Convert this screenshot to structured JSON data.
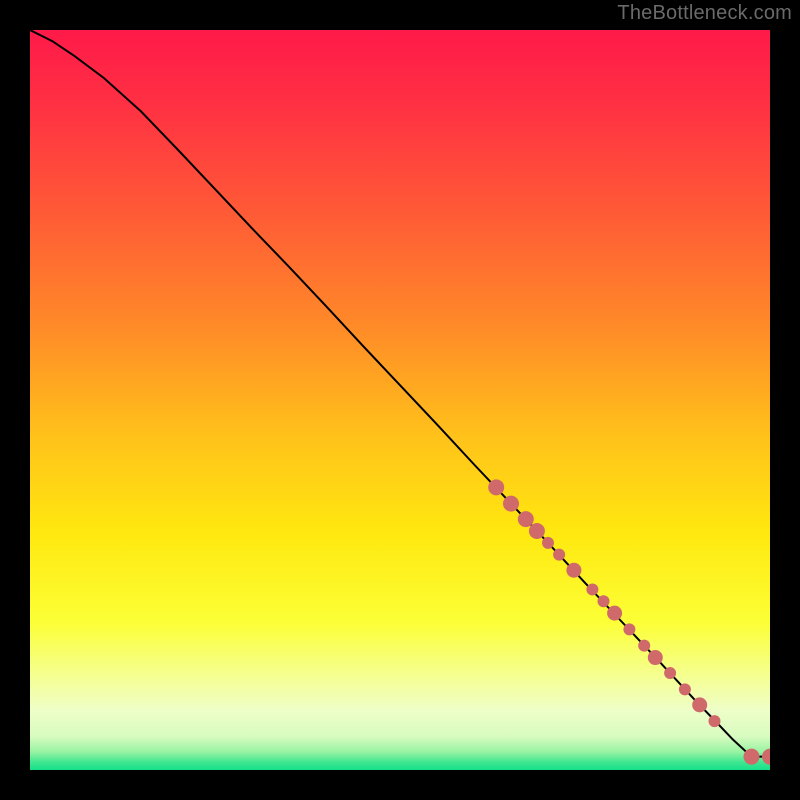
{
  "attribution": "TheBottleneck.com",
  "colors": {
    "frame": "#000000",
    "attribution_text": "#6a6a6a",
    "curve": "#000000",
    "marker_fill": "#d06a6a",
    "marker_stroke": "#c45f5f",
    "gradient_stops": [
      {
        "offset": 0.0,
        "color": "#ff1a49"
      },
      {
        "offset": 0.1,
        "color": "#ff3043"
      },
      {
        "offset": 0.25,
        "color": "#ff5b36"
      },
      {
        "offset": 0.4,
        "color": "#ff8a28"
      },
      {
        "offset": 0.55,
        "color": "#ffc21a"
      },
      {
        "offset": 0.68,
        "color": "#ffe80f"
      },
      {
        "offset": 0.8,
        "color": "#fcff36"
      },
      {
        "offset": 0.88,
        "color": "#f4ff9a"
      },
      {
        "offset": 0.92,
        "color": "#eefec9"
      },
      {
        "offset": 0.955,
        "color": "#d7fbc0"
      },
      {
        "offset": 0.975,
        "color": "#9af3a3"
      },
      {
        "offset": 0.99,
        "color": "#3ce790"
      },
      {
        "offset": 1.0,
        "color": "#16e08a"
      }
    ]
  },
  "chart_data": {
    "type": "line",
    "title": "",
    "xlabel": "",
    "ylabel": "",
    "xlim": [
      0,
      100
    ],
    "ylim": [
      0,
      100
    ],
    "grid": false,
    "series": [
      {
        "name": "curve",
        "x": [
          0,
          3,
          6,
          10,
          15,
          20,
          25,
          30,
          35,
          40,
          45,
          50,
          55,
          60,
          65,
          70,
          75,
          80,
          85,
          90,
          93,
          95,
          97.5,
          100
        ],
        "y": [
          100,
          98.5,
          96.5,
          93.5,
          89,
          83.8,
          78.5,
          73.2,
          68,
          62.7,
          57.3,
          52,
          46.7,
          41.3,
          36,
          30.7,
          25.3,
          20,
          14.7,
          9.3,
          6.2,
          4.1,
          1.8,
          1.8
        ]
      }
    ],
    "markers": {
      "name": "points",
      "x": [
        63,
        65,
        67,
        68.5,
        70,
        71.5,
        73.5,
        76,
        77.5,
        79,
        81,
        83,
        84.5,
        86.5,
        88.5,
        90.5,
        92.5,
        97.5,
        100
      ],
      "y": [
        38.2,
        36,
        33.9,
        32.3,
        30.7,
        29.1,
        27,
        24.4,
        22.8,
        21.2,
        19,
        16.8,
        15.2,
        13.1,
        10.9,
        8.8,
        6.6,
        1.8,
        1.8
      ],
      "r_major": 8,
      "r_minor": 6
    }
  }
}
